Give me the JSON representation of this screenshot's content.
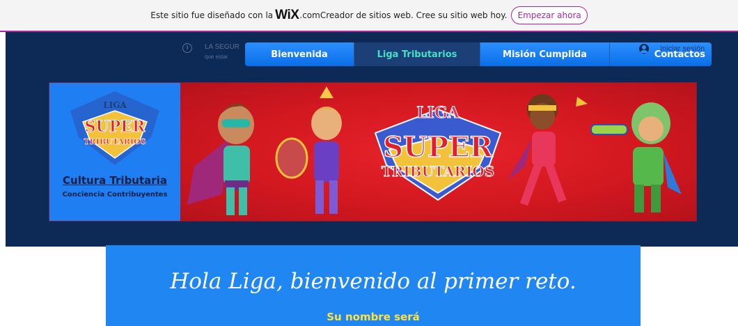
{
  "wix_banner": {
    "text_prefix": "Este sitio fue diseñado con la",
    "wix_logo": "WiX",
    "text_suffix": ".comCreador de sitios web. Cree su sitio web hoy.",
    "cta": "Empezar ahora"
  },
  "notice": {
    "line1": "LA SEGUR",
    "line2": "que estar"
  },
  "nav": {
    "items": [
      {
        "label": "Bienvenida",
        "active": false
      },
      {
        "label": "Liga Tributarios",
        "active": true
      },
      {
        "label": "Misión Cumplida",
        "active": false
      },
      {
        "label": "Contactos",
        "active": false
      }
    ]
  },
  "login": {
    "label": "Iniciar sesión",
    "icon": "user-icon"
  },
  "hero": {
    "logo_small": {
      "liga": "LIGA",
      "super": "SUPER",
      "tributarios": "TRIBUTARIOS"
    },
    "logo_large": {
      "liga": "LIGA",
      "super": "SUPER",
      "tributarios": "TRIBUTARIOS"
    },
    "culture_title": "Cultura Tributaria",
    "culture_subtitle": "Conciencia Contribuyentes"
  },
  "welcome": {
    "title": "Hola Liga, bienvenido al primer reto.",
    "subtitle": "Su nombre será"
  },
  "colors": {
    "wix_accent": "#a8289a",
    "header_bg": "#0c2a55",
    "nav_blue": "#1a7ff0",
    "nav_active_text": "#44e0c5",
    "hero_red": "#d31820",
    "hero_blue": "#1f7ef2",
    "welcome_yellow": "#ffe23a"
  }
}
